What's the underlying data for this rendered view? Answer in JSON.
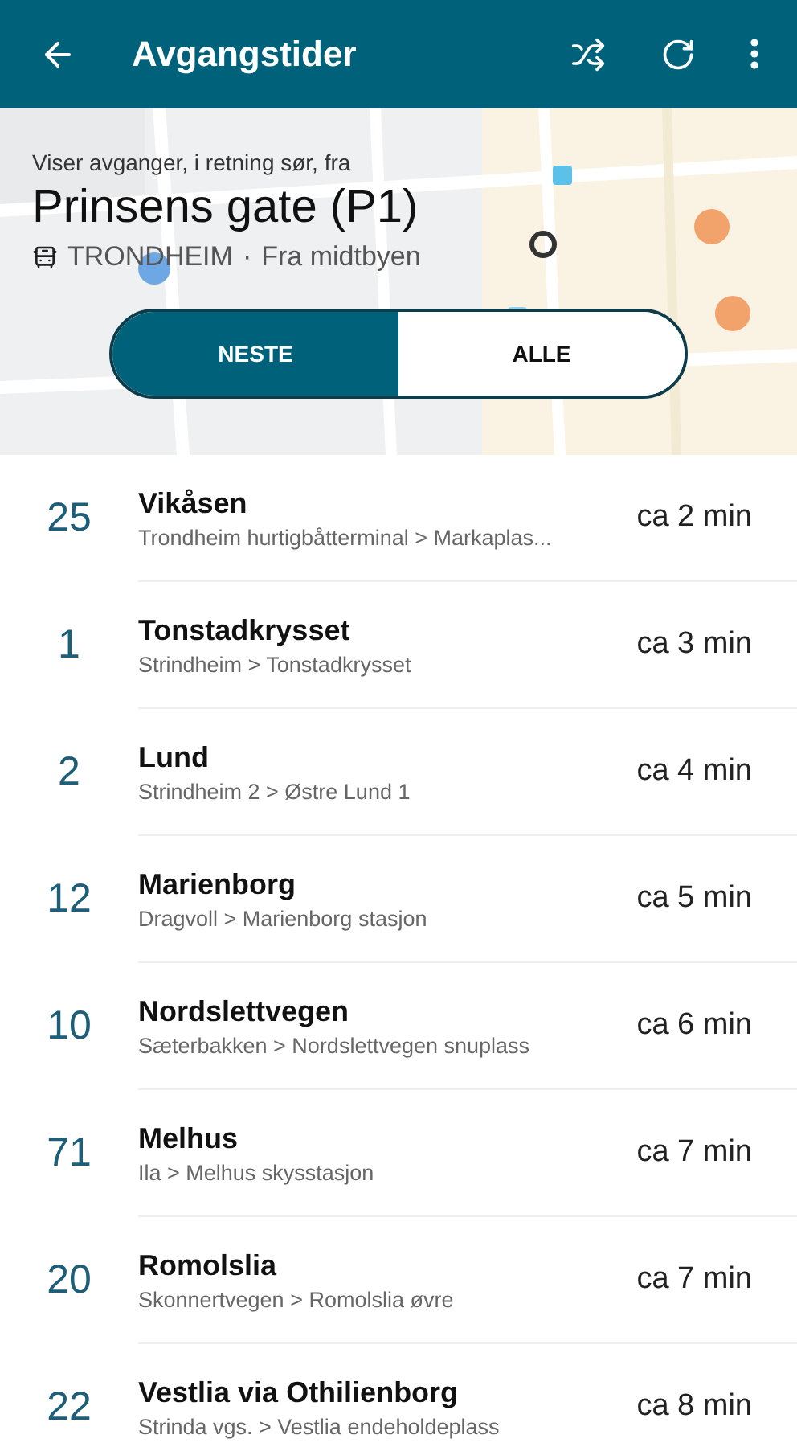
{
  "app_bar": {
    "title": "Avgangstider"
  },
  "stop": {
    "caption": "Viser avganger, i retning sør, fra",
    "name": "Prinsens gate (P1)",
    "city": "TRONDHEIM",
    "separator": "·",
    "direction": "Fra midtbyen"
  },
  "tabs": [
    {
      "label": "NESTE",
      "selected": true
    },
    {
      "label": "ALLE",
      "selected": false
    }
  ],
  "departures": [
    {
      "line": "25",
      "destination": "Vikåsen",
      "route": "Trondheim hurtigbåtterminal > Markaplas...",
      "time": "ca 2 min"
    },
    {
      "line": "1",
      "destination": "Tonstadkrysset",
      "route": "Strindheim > Tonstadkrysset",
      "time": "ca 3 min"
    },
    {
      "line": "2",
      "destination": "Lund",
      "route": "Strindheim 2 > Østre Lund 1",
      "time": "ca 4 min"
    },
    {
      "line": "12",
      "destination": "Marienborg",
      "route": "Dragvoll > Marienborg stasjon",
      "time": "ca 5 min"
    },
    {
      "line": "10",
      "destination": "Nordslettvegen",
      "route": "Sæterbakken > Nordslettvegen snuplass",
      "time": "ca 6 min"
    },
    {
      "line": "71",
      "destination": "Melhus",
      "route": "Ila > Melhus skysstasjon",
      "time": "ca 7 min"
    },
    {
      "line": "20",
      "destination": "Romolslia",
      "route": "Skonnertvegen > Romolslia øvre",
      "time": "ca 7 min"
    },
    {
      "line": "22",
      "destination": "Vestlia via Othilienborg",
      "route": "Strinda vgs. > Vestlia endeholdeplass",
      "time": "ca 8 min"
    }
  ]
}
